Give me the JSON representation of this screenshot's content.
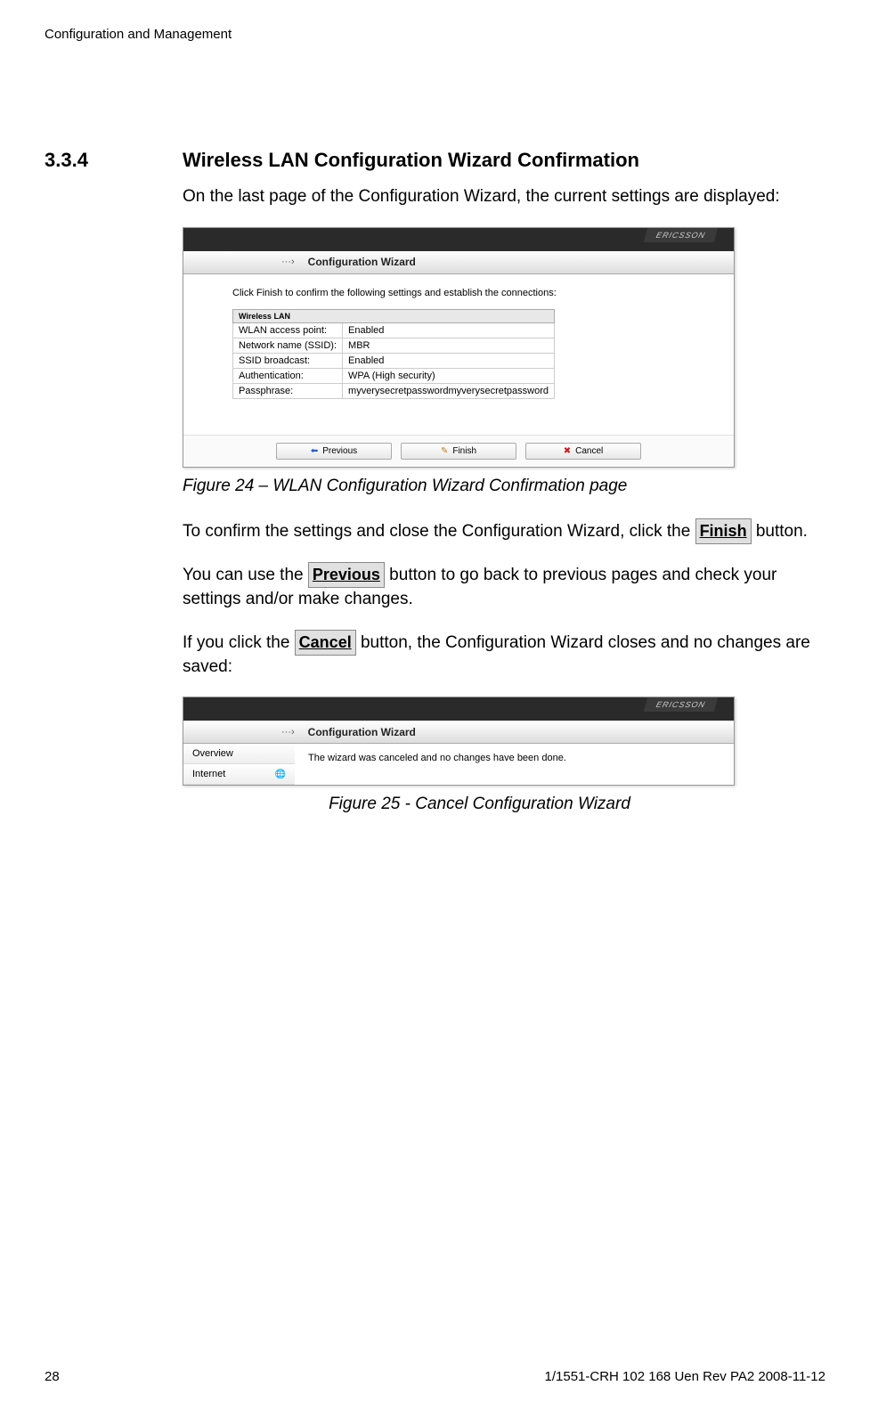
{
  "header": "Configuration and Management",
  "section": {
    "number": "3.3.4",
    "title": "Wireless LAN Configuration Wizard Confirmation"
  },
  "para1": "On the last page of the Configuration Wizard, the current settings are displayed:",
  "screenshot1": {
    "brand": "ERICSSON",
    "navDots": "···›",
    "navTitle": "Configuration Wizard",
    "instruction": "Click Finish to confirm the following settings and establish the connections:",
    "tableHeader": "Wireless LAN",
    "rows": [
      {
        "label": "WLAN access point:",
        "value": "Enabled"
      },
      {
        "label": "Network name (SSID):",
        "value": "MBR"
      },
      {
        "label": "SSID broadcast:",
        "value": "Enabled"
      },
      {
        "label": "Authentication:",
        "value": "WPA (High security)"
      },
      {
        "label": "Passphrase:",
        "value": "myverysecretpasswordmyverysecretpassword"
      }
    ],
    "btnPrevious": "Previous",
    "btnFinish": "Finish",
    "btnCancel": "Cancel"
  },
  "caption1": "Figure 24 – WLAN Configuration Wizard Confirmation page",
  "para2a": "To confirm the settings and close the Configuration Wizard, click the ",
  "btnFinishText": "Finish",
  "para2b": " button.",
  "para3a": "You can use the ",
  "btnPreviousText": "Previous",
  "para3b": " button to go back to previous pages and check your settings and/or make changes.",
  "para4a": "If you click the ",
  "btnCancelText": "Cancel",
  "para4b": " button, the Configuration Wizard closes and no changes are saved:",
  "screenshot2": {
    "brand": "ERICSSON",
    "navDots": "···›",
    "navTitle": "Configuration Wizard",
    "sideOverview": "Overview",
    "sideInternet": "Internet",
    "message": "The wizard was canceled and no changes have been done."
  },
  "caption2": "Figure 25 - Cancel Configuration Wizard",
  "footer": {
    "pageNum": "28",
    "docRef": "1/1551-CRH 102 168 Uen Rev PA2  2008-11-12"
  }
}
